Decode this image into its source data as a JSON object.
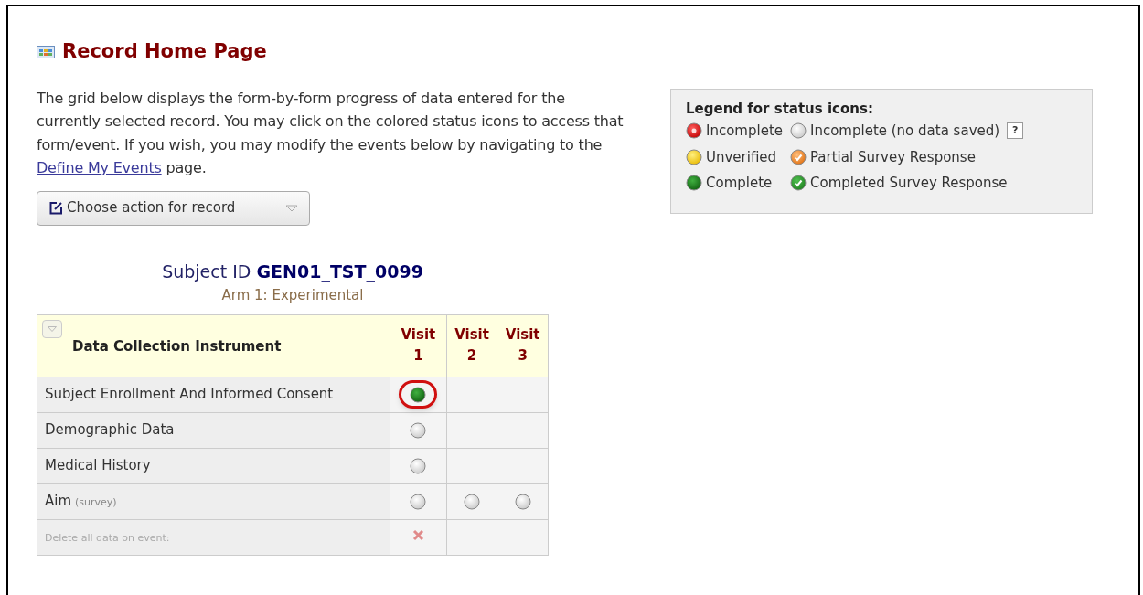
{
  "title": "Record Home Page",
  "intro": {
    "before": "The grid below displays the form-by-form progress of data entered for the currently selected record. You may click on the colored status icons to access that form/event. If you wish, you may modify the events below by navigating to the ",
    "link": "Define My Events",
    "after": " page."
  },
  "action_button": {
    "label": "Choose action for record"
  },
  "legend": {
    "title": "Legend for status icons:",
    "help": "?",
    "items": [
      {
        "kind": "incomplete",
        "label": "Incomplete"
      },
      {
        "kind": "no_data",
        "label": "Incomplete (no data saved)"
      },
      {
        "kind": "unverified",
        "label": "Unverified"
      },
      {
        "kind": "partial_survey",
        "label": "Partial Survey Response"
      },
      {
        "kind": "complete",
        "label": "Complete"
      },
      {
        "kind": "survey_complete",
        "label": "Completed Survey Response"
      }
    ]
  },
  "subject": {
    "label": "Subject ID",
    "id": "GEN01_TST_0099",
    "arm": "Arm 1: Experimental"
  },
  "table": {
    "instrument_header": "Data Collection Instrument",
    "visits": [
      {
        "word": "Visit",
        "number": "1"
      },
      {
        "word": "Visit",
        "number": "2"
      },
      {
        "word": "Visit",
        "number": "3"
      }
    ],
    "rows": [
      {
        "kind": "form",
        "name": "Subject Enrollment And Informed Consent",
        "cells": [
          {
            "kind": "complete",
            "highlighted": true
          },
          {
            "kind": "empty"
          },
          {
            "kind": "empty"
          }
        ]
      },
      {
        "kind": "form",
        "name": "Demographic Data",
        "cells": [
          {
            "kind": "no_data",
            "highlighted": false
          },
          {
            "kind": "empty"
          },
          {
            "kind": "empty"
          }
        ]
      },
      {
        "kind": "form",
        "name": "Medical History",
        "cells": [
          {
            "kind": "no_data",
            "highlighted": false
          },
          {
            "kind": "empty"
          },
          {
            "kind": "empty"
          }
        ]
      },
      {
        "kind": "form",
        "name": "Aim",
        "note": "(survey)",
        "cells": [
          {
            "kind": "no_data",
            "highlighted": false
          },
          {
            "kind": "no_data",
            "highlighted": false
          },
          {
            "kind": "no_data",
            "highlighted": false
          }
        ]
      },
      {
        "kind": "delete",
        "name": "Delete all data on event:",
        "cells": [
          {
            "kind": "delete"
          },
          {
            "kind": "empty"
          },
          {
            "kind": "empty"
          }
        ]
      }
    ]
  }
}
